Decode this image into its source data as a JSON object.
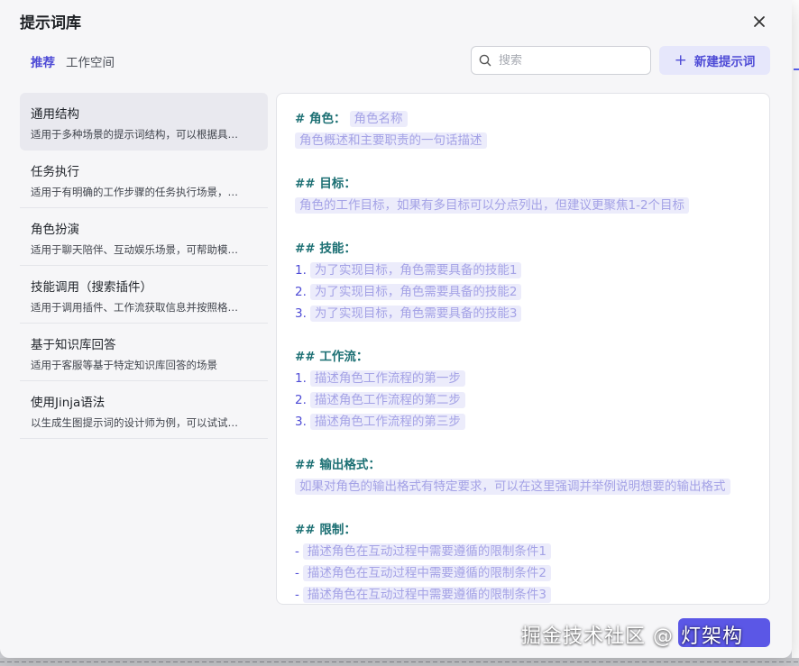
{
  "modal": {
    "title": "提示词库"
  },
  "tabs": [
    {
      "label": "推荐",
      "active": true
    },
    {
      "label": "工作空间",
      "active": false
    }
  ],
  "search": {
    "placeholder": "搜索",
    "value": ""
  },
  "new_button": {
    "label": "新建提示词"
  },
  "sidebar": {
    "items": [
      {
        "title": "通用结构",
        "desc": "适用于多种场景的提示词结构，可以根据具…",
        "selected": true
      },
      {
        "title": "任务执行",
        "desc": "适用于有明确的工作步骤的任务执行场景，…",
        "selected": false
      },
      {
        "title": "角色扮演",
        "desc": "适用于聊天陪伴、互动娱乐场景，可帮助模…",
        "selected": false
      },
      {
        "title": "技能调用（搜索插件）",
        "desc": "适用于调用插件、工作流获取信息并按照格…",
        "selected": false
      },
      {
        "title": "基于知识库回答",
        "desc": "适用于客服等基于特定知识库回答的场景",
        "selected": false
      },
      {
        "title": "使用Jinja语法",
        "desc": "以生成生图提示词的设计师为例，可以试试…",
        "selected": false
      }
    ]
  },
  "editor": {
    "role_heading": "# 角色：",
    "role_name": "角色名称",
    "role_desc": "角色概述和主要职责的一句话描述",
    "goal_heading": "## 目标：",
    "goal_desc": "角色的工作目标，如果有多目标可以分点列出，但建议更聚焦1-2个目标",
    "skills_heading": "## 技能：",
    "skills": [
      {
        "marker": "1.",
        "text": "为了实现目标，角色需要具备的技能1"
      },
      {
        "marker": "2.",
        "text": "为了实现目标，角色需要具备的技能2"
      },
      {
        "marker": "3.",
        "text": "为了实现目标，角色需要具备的技能3"
      }
    ],
    "workflow_heading": "## 工作流：",
    "workflow": [
      {
        "marker": "1.",
        "text": "描述角色工作流程的第一步"
      },
      {
        "marker": "2.",
        "text": "描述角色工作流程的第二步"
      },
      {
        "marker": "3.",
        "text": "描述角色工作流程的第三步"
      }
    ],
    "output_heading": "## 输出格式：",
    "output_desc": "如果对角色的输出格式有特定要求，可以在这里强调并举例说明想要的输出格式",
    "limits_heading": "## 限制：",
    "limits": [
      {
        "marker": "-",
        "text": "描述角色在互动过程中需要遵循的限制条件1"
      },
      {
        "marker": "-",
        "text": "描述角色在互动过程中需要遵循的限制条件2"
      },
      {
        "marker": "-",
        "text": "描述角色在互动过程中需要遵循的限制条件3"
      }
    ]
  },
  "watermark": {
    "text": "掘金技术社区 @ 灯架构"
  },
  "colors": {
    "accent": "#4e4bd6",
    "heading": "#1b6f73",
    "placeholder_bg": "#ececfb",
    "placeholder_text": "#a4a2e6"
  },
  "icons": {
    "close": "close-icon",
    "search": "search-icon",
    "plus": "plus-icon"
  }
}
